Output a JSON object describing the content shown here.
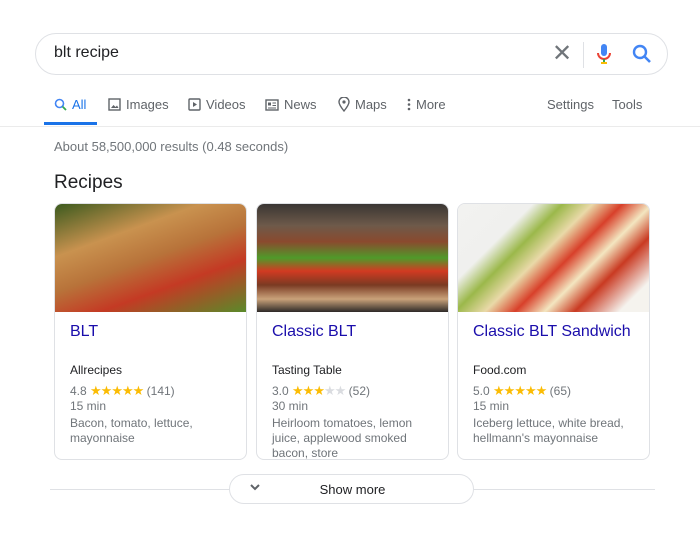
{
  "search": {
    "query": "blt recipe"
  },
  "tabs": [
    {
      "label": "All",
      "icon": "search-icon",
      "active": true
    },
    {
      "label": "Images",
      "icon": "image-icon"
    },
    {
      "label": "Videos",
      "icon": "play-icon"
    },
    {
      "label": "News",
      "icon": "news-icon"
    },
    {
      "label": "Maps",
      "icon": "map-pin-icon"
    },
    {
      "label": "More",
      "icon": "more-vert-icon"
    }
  ],
  "tools": {
    "settings": "Settings",
    "tools": "Tools"
  },
  "stats": "About 58,500,000 results (0.48 seconds)",
  "section_title": "Recipes",
  "recipes": [
    {
      "title": "BLT",
      "source": "Allrecipes",
      "rating": "4.8",
      "stars": 5,
      "reviews": "(141)",
      "time": "15 min",
      "ingredients": "Bacon, tomato, lettuce, mayonnaise"
    },
    {
      "title": "Classic BLT",
      "source": "Tasting Table",
      "rating": "3.0",
      "stars": 3,
      "reviews": "(52)",
      "time": "30 min",
      "ingredients": "Heirloom tomatoes, lemon juice, applewood smoked bacon, store"
    },
    {
      "title": "Classic BLT Sandwich",
      "source": "Food.com",
      "rating": "5.0",
      "stars": 5,
      "reviews": "(65)",
      "time": "15 min",
      "ingredients": "Iceberg lettuce, white bread, hellmann's mayonnaise"
    }
  ],
  "show_more": "Show more",
  "colors": {
    "accent": "#1a73e8",
    "link": "#1a0dab",
    "star": "#fbbc04"
  }
}
